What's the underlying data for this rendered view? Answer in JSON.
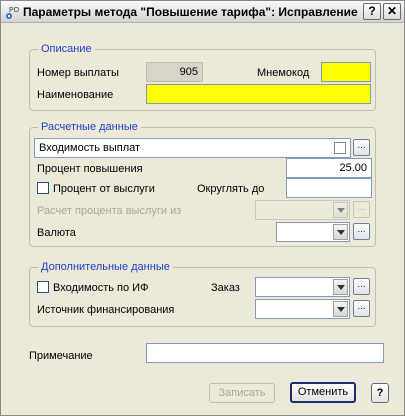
{
  "window": {
    "title": "Параметры метода \"Повышение тарифа\": Исправление",
    "help_label": "?",
    "close_label": "✕"
  },
  "description": {
    "group_title": "Описание",
    "payment_number_label": "Номер выплаты",
    "payment_number_value": "905",
    "mnemocode_label": "Мнемокод",
    "mnemocode_value": "",
    "name_label": "Наименование",
    "name_value": ""
  },
  "calc": {
    "group_title": "Расчетные данные",
    "incoming_label": "Входимость выплат",
    "increase_percent_label": "Процент повышения",
    "increase_percent_value": "25.00",
    "seniority_percent_label": "Процент от выслуги",
    "round_to_label": "Округлять до",
    "round_to_value": "",
    "seniority_calc_label": "Расчет процента выслуги из",
    "seniority_calc_value": "",
    "currency_label": "Валюта",
    "currency_value": ""
  },
  "extra": {
    "group_title": "Дополнительные данные",
    "incoming_if_label": "Входимость по ИФ",
    "order_label": "Заказ",
    "order_value": "",
    "funding_source_label": "Источник финансирования",
    "funding_source_value": ""
  },
  "note": {
    "label": "Примечание",
    "value": ""
  },
  "buttons": {
    "save_label": "Записать",
    "cancel_label": "Отменить",
    "help_label": "?",
    "dots_label": "..."
  }
}
